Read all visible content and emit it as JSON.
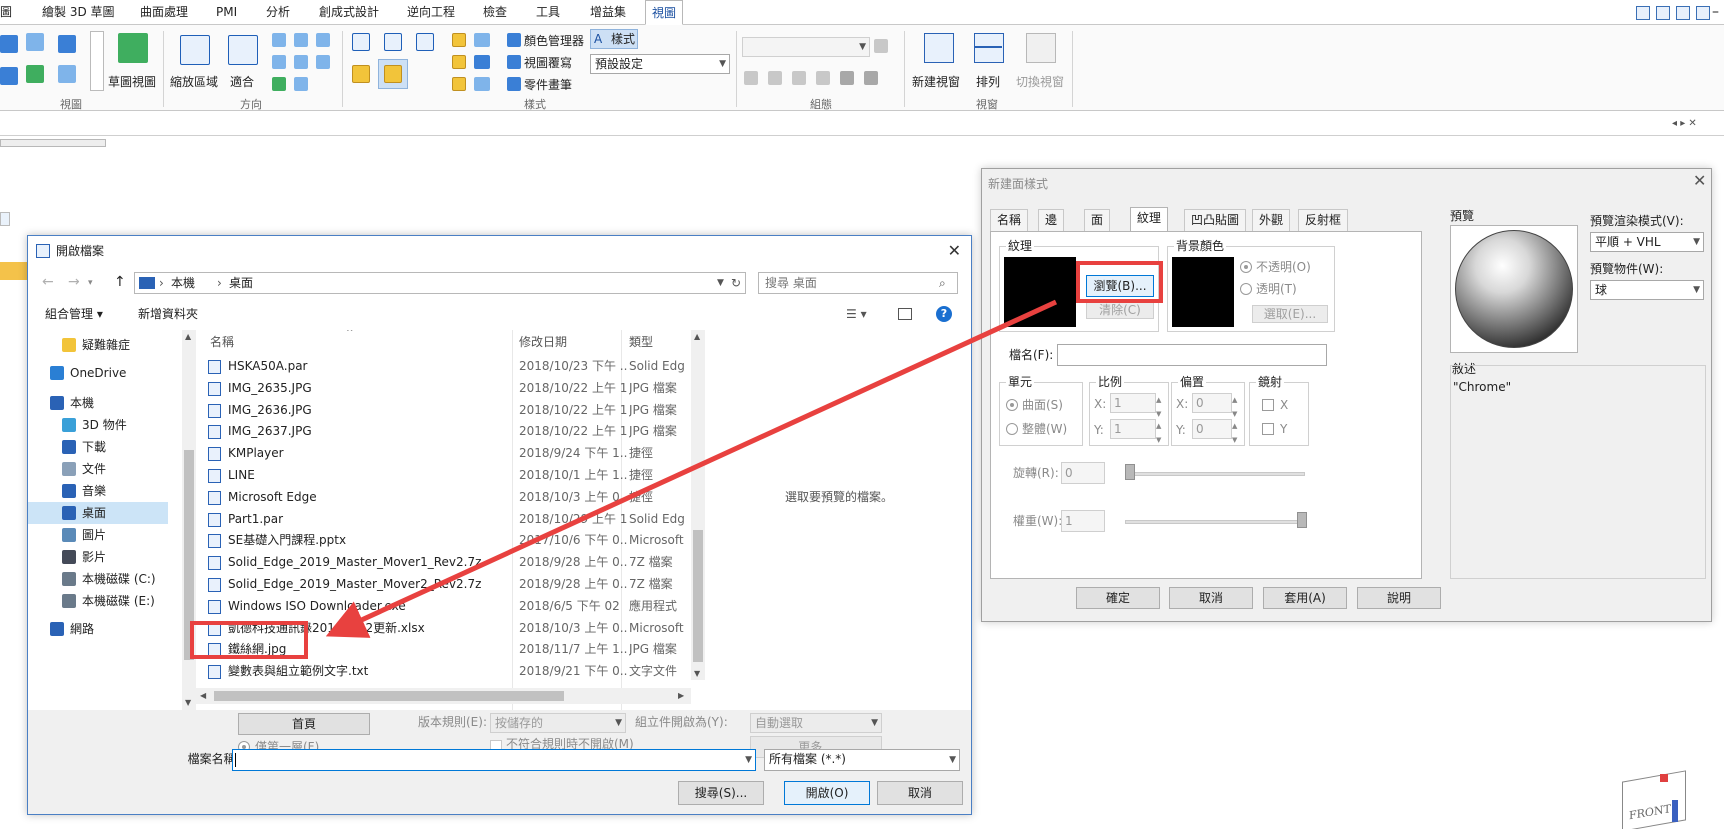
{
  "menubar": {
    "tabs": [
      "圖",
      "繪製 3D 草圖",
      "曲面處理",
      "PMI",
      "分析",
      "創成式設計",
      "逆向工程",
      "檢查",
      "工具",
      "增益集",
      "視圖"
    ],
    "active_tab": "視圖"
  },
  "ribbon": {
    "sketch_view_label": "草圖視圖",
    "zoom_area_label": "縮放區域",
    "fit_label": "適合",
    "color_manager_label": "顏色管理器",
    "view_override_label": "視圖覆寫",
    "part_painter_label": "零件畫筆",
    "style_label": "樣式",
    "style_combo_value": "預設設定",
    "new_window_label": "新建視窗",
    "arrange_label": "排列",
    "switch_window_label": "切換視窗",
    "groups": {
      "view": "視圖",
      "orient": "方向",
      "style": "樣式",
      "group": "組態",
      "window": "視窗"
    }
  },
  "open_dialog": {
    "title": "開啟檔案",
    "breadcrumb": [
      "本機",
      "桌面"
    ],
    "search_placeholder": "搜尋 桌面",
    "organize_label": "組合管理 ▾",
    "new_folder_label": "新增資料夾",
    "columns": {
      "name": "名稱",
      "date": "修改日期",
      "type": "類型"
    },
    "nav": [
      {
        "label": "疑難雜症",
        "color": "#f2c43a",
        "indent": 1
      },
      {
        "label": "OneDrive",
        "color": "#2a7fd4",
        "indent": 0
      },
      {
        "label": "本機",
        "color": "#2a62b5",
        "indent": 0
      },
      {
        "label": "3D 物件",
        "color": "#3aa0d8",
        "indent": 1
      },
      {
        "label": "下載",
        "color": "#2a62b5",
        "indent": 1
      },
      {
        "label": "文件",
        "color": "#8aa0b8",
        "indent": 1
      },
      {
        "label": "音樂",
        "color": "#2a62b5",
        "indent": 1
      },
      {
        "label": "桌面",
        "color": "#2a62b5",
        "indent": 1
      },
      {
        "label": "圖片",
        "color": "#5a8ab8",
        "indent": 1
      },
      {
        "label": "影片",
        "color": "#444a58",
        "indent": 1
      },
      {
        "label": "本機磁碟 (C:)",
        "color": "#6a7a8a",
        "indent": 1
      },
      {
        "label": "本機磁碟 (E:)",
        "color": "#6a7a8a",
        "indent": 1
      },
      {
        "label": "網路",
        "color": "#2a62b5",
        "indent": 0
      }
    ],
    "files": [
      {
        "name": "HSKA50A.par",
        "date": "2018/10/23 下午 ...",
        "type": "Solid Edge"
      },
      {
        "name": "IMG_2635.JPG",
        "date": "2018/10/22 上午 1...",
        "type": "JPG 檔案"
      },
      {
        "name": "IMG_2636.JPG",
        "date": "2018/10/22 上午 1...",
        "type": "JPG 檔案"
      },
      {
        "name": "IMG_2637.JPG",
        "date": "2018/10/22 上午 1...",
        "type": "JPG 檔案"
      },
      {
        "name": "KMPlayer",
        "date": "2018/9/24 下午 1...",
        "type": "捷徑"
      },
      {
        "name": "LINE",
        "date": "2018/10/1 上午 1...",
        "type": "捷徑"
      },
      {
        "name": "Microsoft Edge",
        "date": "2018/10/3 上午 0...",
        "type": "捷徑"
      },
      {
        "name": "Part1.par",
        "date": "2018/10/29 上午 1...",
        "type": "Solid Edge"
      },
      {
        "name": "SE基礎入門課程.pptx",
        "date": "2017/10/6 下午 0...",
        "type": "Microsoft"
      },
      {
        "name": "Solid_Edge_2019_Master_Mover1_Rev2.7z",
        "date": "2018/9/28 上午 0...",
        "type": "7Z 檔案"
      },
      {
        "name": "Solid_Edge_2019_Master_Mover2_Rev2.7z",
        "date": "2018/9/28 上午 0...",
        "type": "7Z 檔案"
      },
      {
        "name": "Windows ISO Downloader.exe",
        "date": "2018/6/5 下午 02",
        "type": "應用程式"
      },
      {
        "name": "凱德科技通訊錄20181002更新.xlsx",
        "date": "2018/10/3 上午 0...",
        "type": "Microsoft"
      },
      {
        "name": "鐵絲網.jpg",
        "date": "2018/11/7 上午 1...",
        "type": "JPG 檔案"
      },
      {
        "name": "變數表與組立範例文字.txt",
        "date": "2018/9/21 下午 0...",
        "type": "文字文件"
      }
    ],
    "preview_text": "選取要預覽的檔案。",
    "home_button": "首頁",
    "version_rule_label": "版本規則(E):",
    "version_rule_value": "按儲存的",
    "assembly_open_label": "組立件開啟為(Y):",
    "assembly_open_value": "自動選取",
    "first_level_label": "僅第一層(F)",
    "no_match_label": "不符合規則時不開啟(M)",
    "more_button": "更多...",
    "filename_label": "檔案名稱(N):",
    "filename_value": "",
    "filetype_value": "所有檔案 (*.*)",
    "search_button": "搜尋(S)...",
    "open_button": "開啟(O)",
    "cancel_button": "取消"
  },
  "style_dialog": {
    "title": "新建面樣式",
    "tabs": [
      "名稱",
      "邊",
      "面",
      "紋理",
      "凹凸貼圖",
      "外觀",
      "反射框"
    ],
    "active_tab": "紋理",
    "texture_group": "紋理",
    "browse_button": "瀏覽(B)...",
    "clear_button": "清除(C)",
    "bg_color_group": "背景顏色",
    "opaque_label": "不透明(O)",
    "transparent_label": "透明(T)",
    "select_button": "選取(E)...",
    "filename_label": "檔名(F):",
    "unit_group": "單元",
    "per_face_label": "曲面(S)",
    "per_body_label": "整體(W)",
    "scale_group": "比例",
    "offset_group": "偏置",
    "mirror_group": "鏡射",
    "scale_x": "1",
    "scale_y": "1",
    "offset_x": "0",
    "offset_y": "0",
    "x_label": "X:",
    "y_label": "Y:",
    "mirror_x": "X",
    "mirror_y": "Y",
    "rotation_label": "旋轉(R):",
    "rotation_value": "0",
    "weight_label": "權重(W):",
    "weight_value": "1",
    "preview_label": "預覽",
    "render_mode_label": "預覽渲染模式(V):",
    "render_mode_value": "平順 + VHL",
    "preview_object_label": "預覽物件(W):",
    "preview_object_value": "球",
    "description_label": "敘述",
    "description_value": "\"Chrome\"",
    "ok_button": "確定",
    "cancel_button": "取消",
    "apply_button": "套用(A)",
    "help_button": "說明"
  },
  "viewcube_label": "FRONT",
  "colors": {
    "accent": "#0078d7",
    "annotation_red": "#e8413f",
    "ribbon_blue": "#1a4fa0"
  }
}
